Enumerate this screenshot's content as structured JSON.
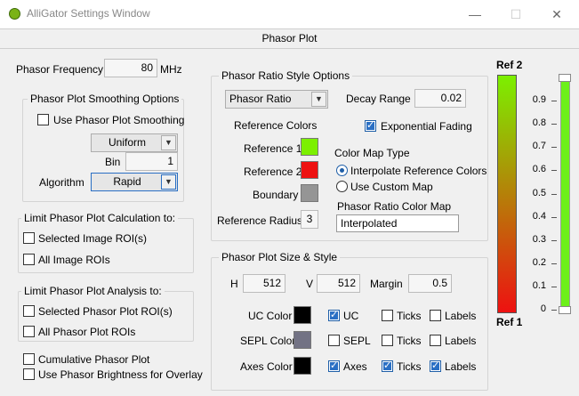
{
  "window": {
    "title": "AlliGator Settings Window",
    "minimize": "—",
    "maximize": "☐",
    "close": "✕"
  },
  "tab": {
    "label": "Phasor Plot"
  },
  "frequency": {
    "label": "Phasor Frequency",
    "value": "80",
    "unit": "MHz"
  },
  "smoothing": {
    "title": "Phasor Plot Smoothing Options",
    "use_label": "Use Phasor Plot Smoothing",
    "use_checked": false,
    "filter": "Uniform",
    "bin_label": "Bin",
    "bin_value": "1",
    "algorithm_label": "Algorithm",
    "algorithm": "Rapid"
  },
  "calculation": {
    "title": "Limit Phasor Plot Calculation  to:",
    "selected_image_roi": "Selected Image ROI(s)",
    "all_image_rois": "All Image ROIs"
  },
  "analysis": {
    "title": "Limit Phasor Plot Analysis  to:",
    "selected_roi": "Selected Phasor Plot ROI(s)",
    "all_rois": "All Phasor Plot ROIs"
  },
  "bottom": {
    "cumulative": "Cumulative Phasor Plot",
    "brightness": "Use Phasor Brightness for Overlay"
  },
  "ratio_style": {
    "title": "Phasor Ratio Style Options",
    "mode": "Phasor Ratio",
    "decay_range_label": "Decay Range",
    "decay_range": "0.02",
    "exp_fading_label": "Exponential Fading",
    "exp_fading": true,
    "reference_colors_label": "Reference Colors",
    "reference1_label": "Reference 1",
    "reference1_color": "#7cf000",
    "reference2_label": "Reference 2",
    "reference2_color": "#ee1111",
    "boundary_label": "Boundary",
    "boundary_color": "#959595",
    "reference_radius_label": "Reference Radius",
    "reference_radius": "3",
    "color_map_type_label": "Color Map Type",
    "interpolate_label": "Interpolate Reference Colors",
    "custom_map_label": "Use Custom Map",
    "color_map_label": "Phasor Ratio Color Map",
    "color_map_value": "Interpolated"
  },
  "size_style": {
    "title": "Phasor Plot Size & Style",
    "h_label": "H",
    "h_value": "512",
    "v_label": "V",
    "v_value": "512",
    "margin_label": "Margin",
    "margin_value": "0.5",
    "uc_color_label": "UC Color",
    "uc_color": "#000000",
    "sepl_color_label": "SEPL Color",
    "sepl_color": "#727284",
    "axes_color_label": "Axes Color",
    "axes_color": "#000000",
    "uc_label": "UC",
    "sepl_label": "SEPL",
    "axes_label": "Axes",
    "ticks_label": "Ticks",
    "labels_label": "Labels"
  },
  "legend": {
    "top_label": "Ref 2",
    "bottom_label": "Ref 1",
    "ticks": [
      "0.9",
      "0.8",
      "0.7",
      "0.6",
      "0.5",
      "0.4",
      "0.3",
      "0.2",
      "0.1",
      "0"
    ],
    "slider_value": 1.0
  }
}
